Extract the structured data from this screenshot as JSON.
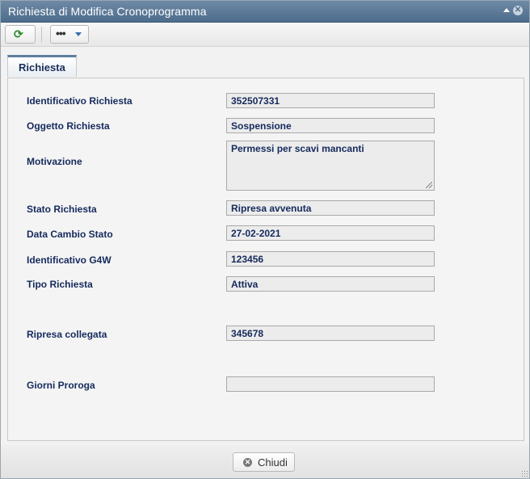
{
  "window": {
    "title": "Richiesta di Modifica Cronoprogramma",
    "close_glyph": "✕",
    "collapse_icon": "chevron-up-icon"
  },
  "toolbar": {
    "refresh_icon": "refresh-icon",
    "refresh_glyph": "⟳",
    "more_glyph": "•••",
    "more_icon": "dropdown-caret-icon"
  },
  "tabs": [
    {
      "label": "Richiesta"
    }
  ],
  "form": {
    "identificativo_richiesta": {
      "label": "Identificativo Richiesta",
      "value": "352507331"
    },
    "oggetto_richiesta": {
      "label": "Oggetto Richiesta",
      "value": "Sospensione"
    },
    "motivazione": {
      "label": "Motivazione",
      "value": "Permessi per scavi mancanti"
    },
    "stato_richiesta": {
      "label": "Stato Richiesta",
      "value": "Ripresa avvenuta"
    },
    "data_cambio_stato": {
      "label": "Data Cambio Stato",
      "value": "27-02-2021"
    },
    "identificativo_g4w": {
      "label": "Identificativo G4W",
      "value": "123456"
    },
    "tipo_richiesta": {
      "label": "Tipo Richiesta",
      "value": "Attiva"
    },
    "ripresa_collegata": {
      "label": "Ripresa collegata",
      "value": "345678"
    },
    "giorni_proroga": {
      "label": "Giorni Proroga",
      "value": ""
    }
  },
  "footer": {
    "close_label": "Chiudi",
    "close_glyph": "✕"
  },
  "colors": {
    "titlebar": "#5a7896",
    "label_text": "#152a5c",
    "refresh_icon": "#2f8a2f"
  }
}
